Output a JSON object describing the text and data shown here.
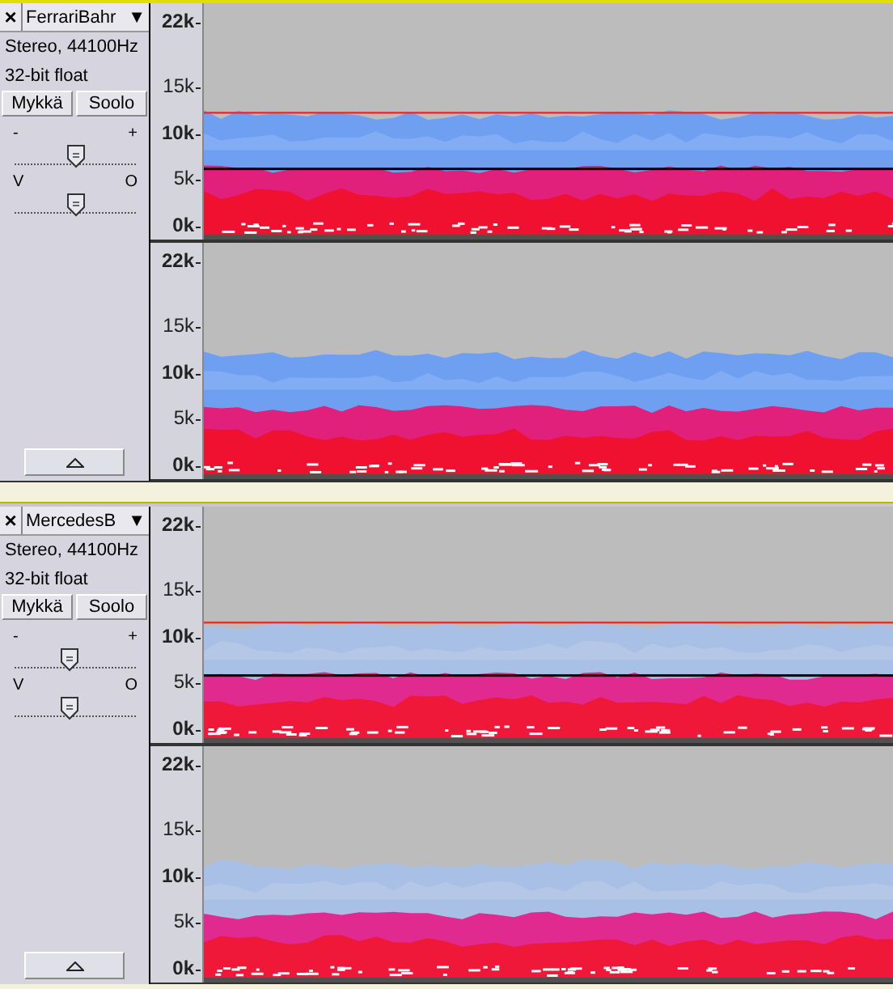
{
  "tracks": [
    {
      "close": "×",
      "name": "FerrariBahr",
      "menu_arrow": "▼",
      "focused": true,
      "info": [
        "Stereo, 44100Hz",
        "32-bit float"
      ],
      "mute": "Mykkä",
      "solo": "Soolo",
      "gain": {
        "min": "-",
        "max": "+",
        "level": 0.5
      },
      "pan": {
        "min": "V",
        "max": "O",
        "level": 0.5
      },
      "faint": false,
      "channels": [
        {
          "selection": true,
          "ruler": [
            {
              "label": "22k",
              "major": true
            },
            {
              "label": "15k",
              "major": false
            },
            {
              "label": "10k",
              "major": true
            },
            {
              "label": "5k",
              "major": false
            },
            {
              "label": "0k",
              "major": true
            }
          ]
        },
        {
          "selection": false,
          "ruler": [
            {
              "label": "22k",
              "major": true
            },
            {
              "label": "15k",
              "major": false
            },
            {
              "label": "10k",
              "major": true
            },
            {
              "label": "5k",
              "major": false
            },
            {
              "label": "0k",
              "major": true
            }
          ]
        }
      ]
    },
    {
      "close": "×",
      "name": "MercedesB",
      "menu_arrow": "▼",
      "focused": false,
      "info": [
        "Stereo, 44100Hz",
        "32-bit float"
      ],
      "mute": "Mykkä",
      "solo": "Soolo",
      "gain": {
        "min": "-",
        "max": "+",
        "level": 0.45
      },
      "pan": {
        "min": "V",
        "max": "O",
        "level": 0.45
      },
      "faint": true,
      "channels": [
        {
          "selection": true,
          "ruler": [
            {
              "label": "22k",
              "major": true
            },
            {
              "label": "15k",
              "major": false
            },
            {
              "label": "10k",
              "major": true
            },
            {
              "label": "5k",
              "major": false
            },
            {
              "label": "0k",
              "major": true
            }
          ]
        },
        {
          "selection": false,
          "ruler": [
            {
              "label": "22k",
              "major": true
            },
            {
              "label": "15k",
              "major": false
            },
            {
              "label": "10k",
              "major": true
            },
            {
              "label": "5k",
              "major": false
            },
            {
              "label": "0k",
              "major": true
            }
          ]
        }
      ]
    }
  ]
}
